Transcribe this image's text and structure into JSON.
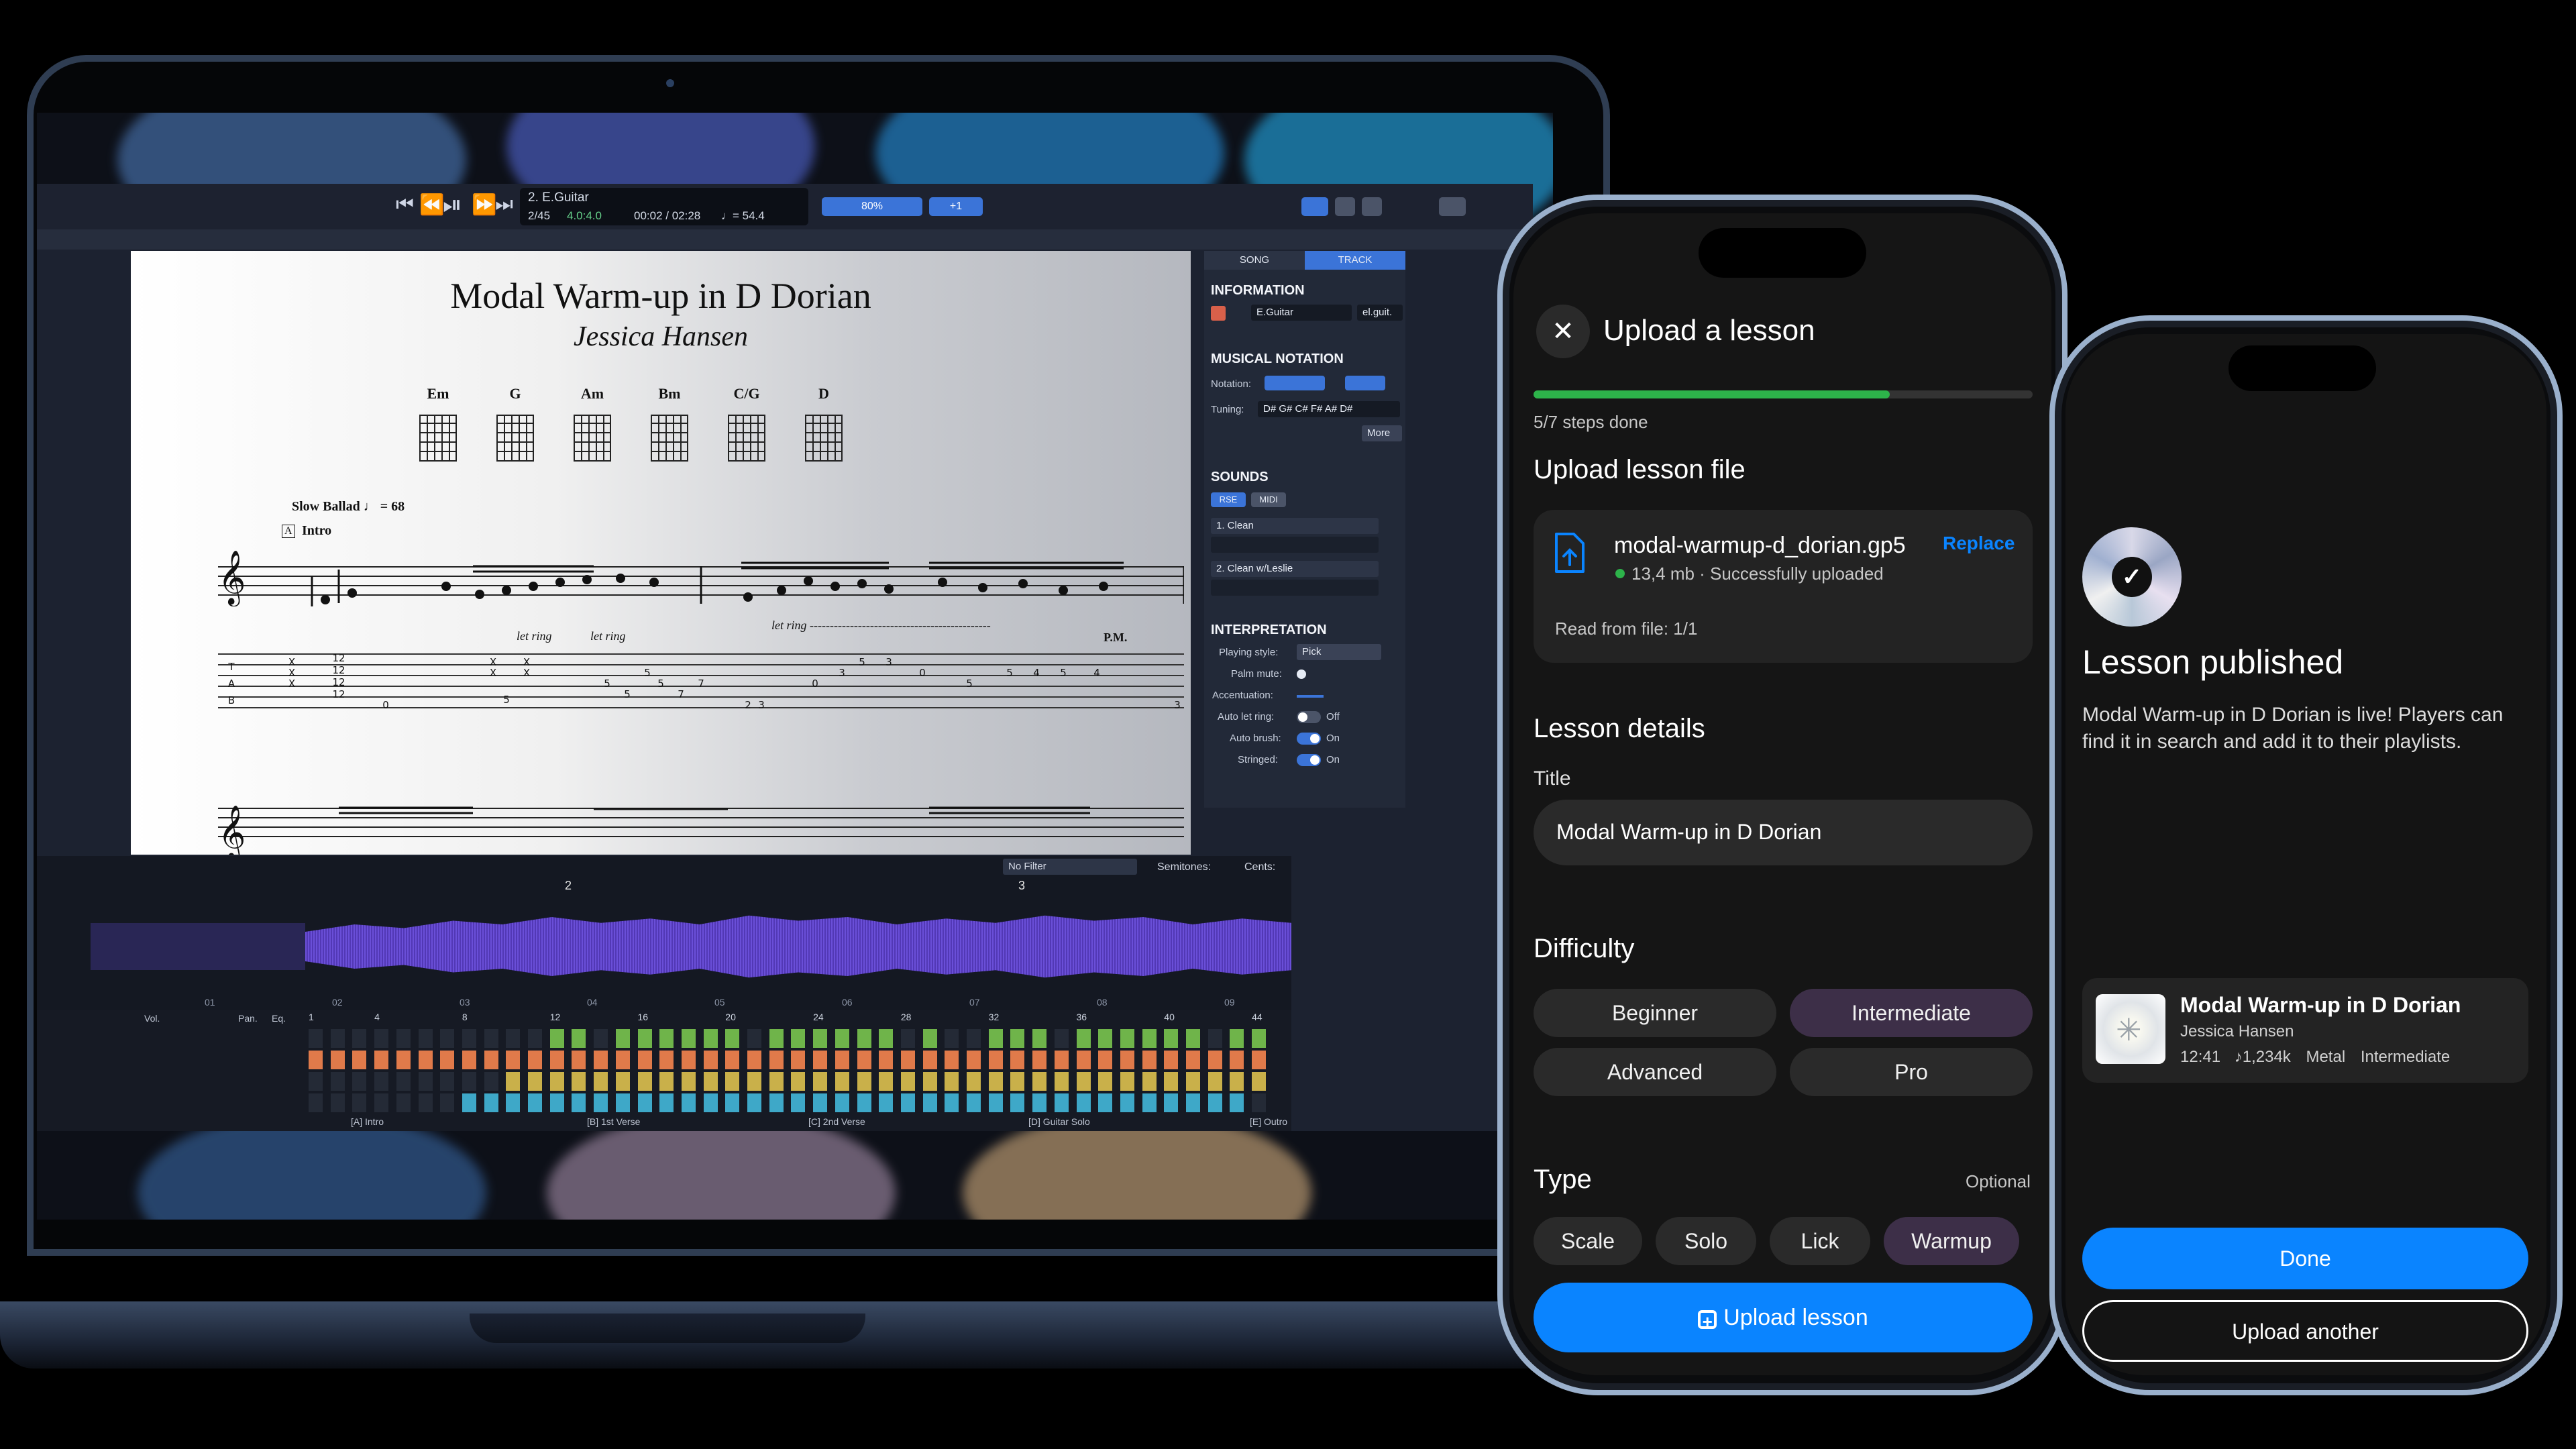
{
  "colors": {
    "accent_blue": "#0a84ff",
    "progress_green": "#2db34a",
    "chip_selected": "#3d2f48",
    "chip_default": "#2a2a2a",
    "guitar_pro_blue": "#3b74d8"
  },
  "laptop": {
    "toolbar": {
      "track_name": "2. E.Guitar",
      "position": "2/45",
      "time_signature": "4.0:4.0",
      "time": "00:02 / 02:28",
      "tempo": "♩= 54.4",
      "zoom": "80%",
      "transpose": "+1"
    },
    "score": {
      "title": "Modal Warm-up in D Dorian",
      "composer": "Jessica Hansen",
      "chords": [
        "Em",
        "G",
        "Am",
        "Bm",
        "C/G",
        "D"
      ],
      "tempo_mark": "Slow Ballad ♩ = 68",
      "section": "Intro",
      "section_letter": "A",
      "let_ring_1": "let ring",
      "let_ring_2": "let ring",
      "let_ring_3": "let ring ---------------------------------------------",
      "pm": "P.M.",
      "tab_label": "T\nA\nB"
    },
    "inspector": {
      "tabs": [
        "SONG",
        "TRACK"
      ],
      "information": "INFORMATION",
      "track_name": "E.Guitar",
      "track_short": "el.guit.",
      "musical_notation": "MUSICAL NOTATION",
      "notation_label": "Notation:",
      "tuning_label": "Tuning:",
      "tuning_value": "D# G# C# F# A# D#",
      "more": "More",
      "sounds": "SOUNDS",
      "sound_tabs": [
        "RSE",
        "MIDI"
      ],
      "sound_1": "1. Clean",
      "sound_2": "2. Clean w/Leslie",
      "interpretation": "INTERPRETATION",
      "playing_style_label": "Playing style:",
      "playing_style_value": "Pick",
      "palm_mute": "Palm mute:",
      "accentuation": "Accentuation:",
      "auto_let_ring": "Auto let ring:",
      "auto_let_ring_value": "Off",
      "auto_brush": "Auto brush:",
      "auto_brush_value": "On",
      "stringed": "Stringed:",
      "stringed_value": "On"
    },
    "audio": {
      "filter": "No Filter",
      "semitones": "Semitones:",
      "cents": "Cents:",
      "marker_2": "2",
      "marker_3": "3",
      "time_ticks": [
        "01",
        "02",
        "03",
        "04",
        "05",
        "06",
        "07",
        "08",
        "09"
      ]
    },
    "tracks": {
      "vol": "Vol.",
      "pan": "Pan.",
      "eq": "Eq.",
      "ruler": [
        "1",
        "4",
        "8",
        "12",
        "16",
        "20",
        "24",
        "28",
        "32",
        "36",
        "40",
        "44"
      ],
      "sections": [
        {
          "letter": "A",
          "name": "Intro"
        },
        {
          "letter": "B",
          "name": "1st Verse"
        },
        {
          "letter": "C",
          "name": "2nd Verse"
        },
        {
          "letter": "D",
          "name": "Guitar Solo"
        },
        {
          "letter": "E",
          "name": "Outro"
        }
      ]
    }
  },
  "upload_phone": {
    "close_icon": "close-icon",
    "title": "Upload a lesson",
    "progress": 0.714,
    "steps_text": "5/7 steps done",
    "file_section_title": "Upload lesson file",
    "file_icon": "file-upload-icon",
    "file_name": "modal-warmup-d_dorian.gp5",
    "file_status": "13,4 mb · Successfully uploaded",
    "replace_label": "Replace",
    "read_from_file": "Read from file: 1/1",
    "details_title": "Lesson details",
    "title_label": "Title",
    "title_value": "Modal Warm-up in D Dorian",
    "difficulty_title": "Difficulty",
    "difficulty_options": [
      "Beginner",
      "Intermediate",
      "Advanced",
      "Pro"
    ],
    "difficulty_selected": "Intermediate",
    "type_title": "Type",
    "type_optional": "Optional",
    "type_options": [
      "Scale",
      "Solo",
      "Lick",
      "Warmup"
    ],
    "type_selected": "Warmup",
    "upload_button": "Upload lesson"
  },
  "published_phone": {
    "title": "Lesson published",
    "message": "Modal Warm-up in D Dorian is live! Players can find it in search and add it to their playlists.",
    "card": {
      "title": "Modal Warm-up in D Dorian",
      "author": "Jessica Hansen",
      "duration": "12:41",
      "plays": "1,234k",
      "genre": "Metal",
      "level": "Intermediate"
    },
    "done_button": "Done",
    "upload_another_button": "Upload another"
  }
}
